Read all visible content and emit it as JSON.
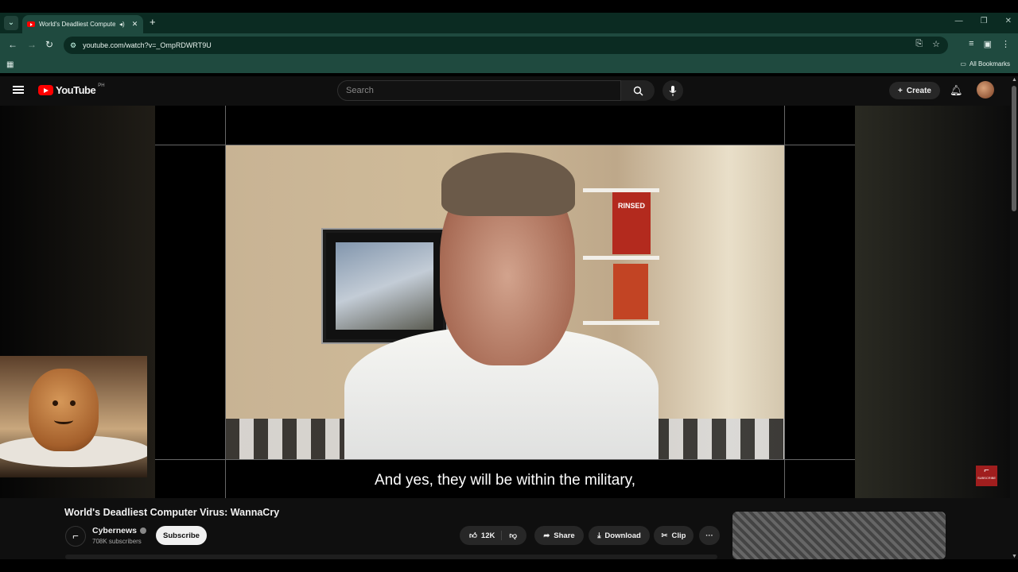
{
  "browser": {
    "tab_title": "World's Deadliest Computer Virus: WannaCry",
    "audio_icon": "speaker-icon",
    "url": "youtube.com/watch?v=_OmpRDWRT9U",
    "bookmarks_label": "All Bookmarks"
  },
  "youtube": {
    "logo_text": "YouTube",
    "region": "PH",
    "search_placeholder": "Search",
    "create_label": "Create"
  },
  "video": {
    "caption": "And yes, they will be within the military,",
    "book_title": "RINSED",
    "title": "World's Deadliest Computer Virus: WannaCry",
    "watermark": "SUBSCRIBE"
  },
  "channel": {
    "name": "Cybernews",
    "subscribers": "708K subscribers",
    "subscribe_label": "Subscribe"
  },
  "actions": {
    "likes": "12K",
    "share": "Share",
    "download": "Download",
    "clip": "Clip"
  },
  "colors": {
    "accent": "#ff0000",
    "browser_frame": "#1f4a3f"
  }
}
